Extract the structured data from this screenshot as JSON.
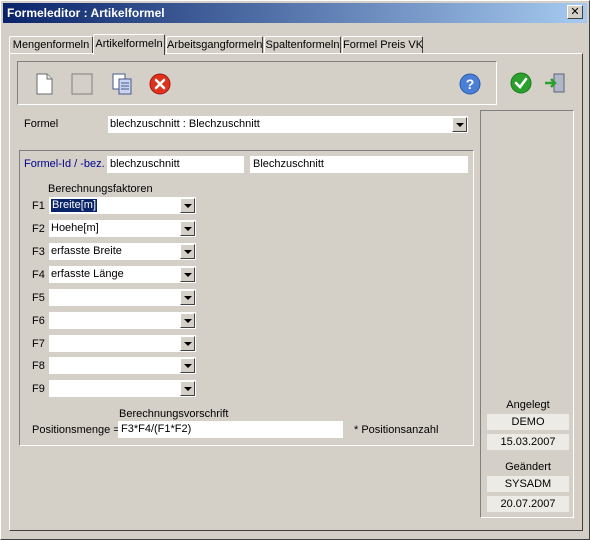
{
  "window": {
    "title": "Formeleditor : Artikelformel",
    "close_glyph": "✕"
  },
  "tabs": [
    {
      "label": "Mengenformeln"
    },
    {
      "label": "Artikelformeln",
      "active": true
    },
    {
      "label": "Arbeitsgangformeln"
    },
    {
      "label": "Spaltenformeln"
    },
    {
      "label": "Formel Preis VK"
    }
  ],
  "toolbar": {
    "icons": [
      "new-document-icon",
      "blank-icon",
      "copy-icon",
      "delete-icon"
    ],
    "help_icon": "help-icon",
    "confirm_icon": "checkmark-icon",
    "exit_icon": "exit-door-icon"
  },
  "formel": {
    "label": "Formel",
    "value": "blechzuschnitt : Blechzuschnitt"
  },
  "formel_id": {
    "label": "Formel-Id / -bez.",
    "id": "blechzuschnitt",
    "bez": "Blechzuschnitt"
  },
  "faktoren": {
    "header": "Berechnungsfaktoren",
    "rows": [
      {
        "label": "F1",
        "value": "Breite[m]",
        "selected": true
      },
      {
        "label": "F2",
        "value": "Hoehe[m]"
      },
      {
        "label": "F3",
        "value": "erfasste Breite"
      },
      {
        "label": "F4",
        "value": "erfasste Länge"
      },
      {
        "label": "F5",
        "value": ""
      },
      {
        "label": "F6",
        "value": ""
      },
      {
        "label": "F7",
        "value": ""
      },
      {
        "label": "F8",
        "value": ""
      },
      {
        "label": "F9",
        "value": ""
      }
    ]
  },
  "vorschrift": {
    "header": "Berechnungsvorschrift",
    "prefix": "Positionsmenge =",
    "formula": "F3*F4/(F1*F2)",
    "suffix": "* Positionsanzahl"
  },
  "meta": {
    "angelegt_label": "Angelegt",
    "angelegt_user": "DEMO",
    "angelegt_date": "15.03.2007",
    "geaendert_label": "Geändert",
    "geaendert_user": "SYSADM",
    "geaendert_date": "20.07.2007"
  },
  "colors": {
    "title_bg": "#0a246a",
    "label_blue": "#00008b",
    "selection": "#0a246a"
  }
}
